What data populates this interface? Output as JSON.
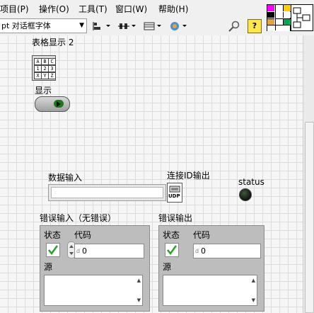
{
  "menu": {
    "items": [
      "项目(P)",
      "操作(O)",
      "工具(T)",
      "窗口(W)",
      "帮助(H)"
    ]
  },
  "toolbar": {
    "font_select": "pt 对话框字体",
    "help_glyph": "?"
  },
  "front_panel": {
    "table": {
      "label": "表格显示 2",
      "glyph_rows": [
        [
          "A",
          "B",
          "C"
        ],
        [
          "1",
          "2",
          "3"
        ],
        [
          "X",
          "Y",
          "Z"
        ]
      ]
    },
    "display_button": {
      "label": "显示"
    },
    "data_input": {
      "label": "数据输入",
      "value": ""
    },
    "connection_id": {
      "label": "连接ID输出",
      "icon_text": "UDP"
    },
    "status": {
      "label": "status"
    },
    "error_in": {
      "label": "错误输入（无错误）",
      "status_label": "状态",
      "code_label": "代码",
      "code_value": "0",
      "source_label": "源"
    },
    "error_out": {
      "label": "错误输出",
      "status_label": "状态",
      "code_label": "代码",
      "code_value": "0",
      "source_label": "源"
    }
  },
  "colors": {
    "led_off": "#2f4a2b",
    "check_green": "#2aa02a",
    "cluster_bg": "#bdbdbd"
  }
}
